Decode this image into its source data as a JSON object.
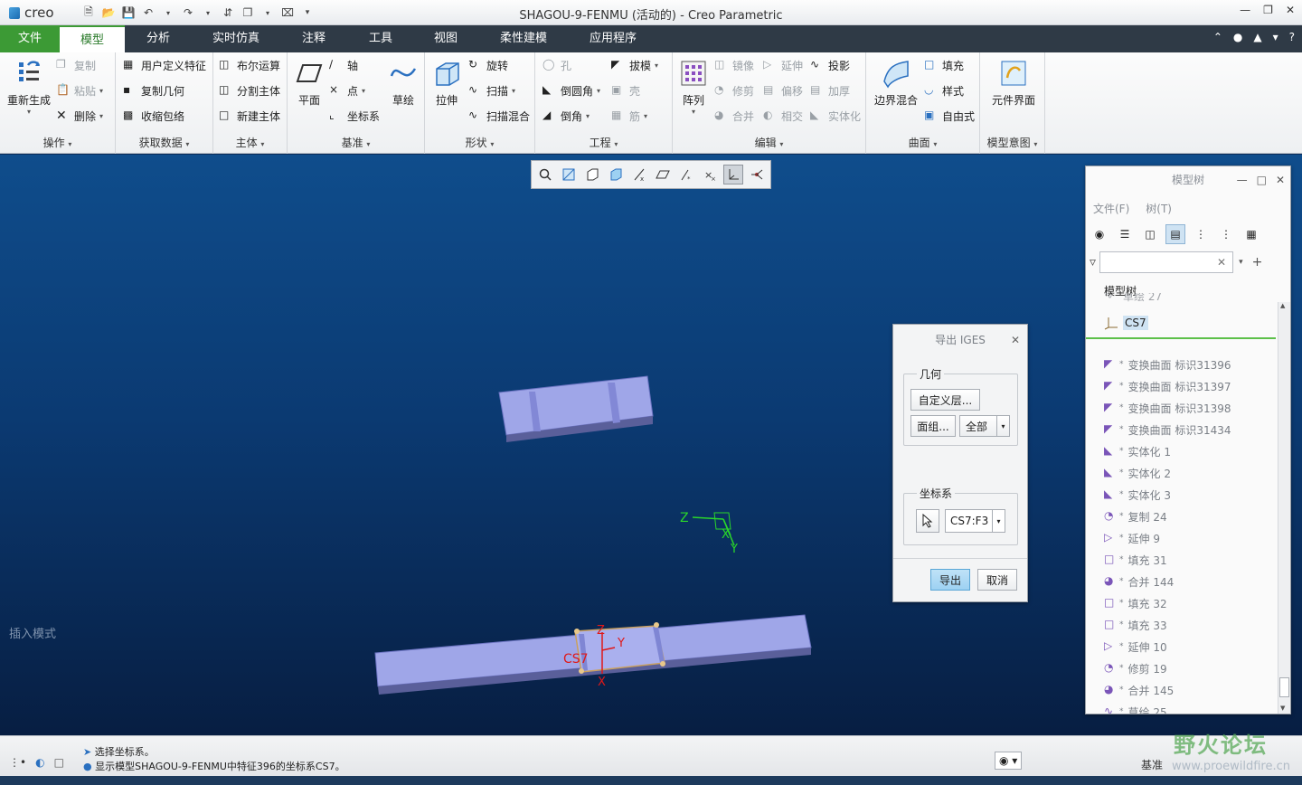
{
  "app": {
    "logo": "creo",
    "title": "SHAGOU-9-FENMU (活动的) - Creo Parametric"
  },
  "tabs": [
    {
      "label": "文件"
    },
    {
      "label": "模型"
    },
    {
      "label": "分析"
    },
    {
      "label": "实时仿真"
    },
    {
      "label": "注释"
    },
    {
      "label": "工具"
    },
    {
      "label": "视图"
    },
    {
      "label": "柔性建模"
    },
    {
      "label": "应用程序"
    }
  ],
  "ribbon": {
    "operations": {
      "label": "操作",
      "regenerate": "重新生成",
      "copy": "复制",
      "paste": "粘贴",
      "delete": "删除"
    },
    "get_data": {
      "label": "获取数据",
      "udf": "用户定义特征",
      "copy_geom": "复制几何",
      "shrinkwrap": "收缩包络"
    },
    "body": {
      "label": "主体",
      "boolean": "布尔运算",
      "split": "分割主体",
      "new_body": "新建主体"
    },
    "datum": {
      "label": "基准",
      "plane": "平面",
      "axis": "轴",
      "point": "点",
      "csys": "坐标系",
      "sketch": "草绘"
    },
    "shapes": {
      "label": "形状",
      "extrude": "拉伸",
      "revolve": "旋转",
      "sweep": "扫描",
      "swept_blend": "扫描混合"
    },
    "engineering": {
      "label": "工程",
      "hole": "孔",
      "round": "倒圆角",
      "chamfer": "倒角",
      "draft": "拔模",
      "shell": "壳",
      "rib": "筋"
    },
    "editing": {
      "label": "编辑",
      "pattern": "阵列",
      "mirror": "镜像",
      "extend": "延伸",
      "project": "投影",
      "trim": "修剪",
      "offset": "偏移",
      "thicken": "加厚",
      "merge": "合并",
      "intersect": "相交",
      "solidify": "实体化"
    },
    "surfaces": {
      "label": "曲面",
      "boundary_blend": "边界混合",
      "fill": "填充",
      "style": "样式",
      "freestyle": "自由式"
    },
    "model_intent": {
      "label": "模型意图",
      "component_interface": "元件界面"
    }
  },
  "viewport": {
    "insert_mode": "插入模式",
    "csys_label_top": [
      "Z",
      "X",
      "Y"
    ],
    "csys_label_part": [
      "CS7",
      "Z",
      "Y",
      "X"
    ]
  },
  "iges_dialog": {
    "title": "导出 IGES",
    "geometry_legend": "几何",
    "custom_layers": "自定义层...",
    "face_group": "面组...",
    "all": "全部",
    "csys_legend": "坐标系",
    "csys_value": "CS7:F3",
    "export": "导出",
    "cancel": "取消"
  },
  "model_tree": {
    "title": "模型树",
    "menu_file": "文件(F)",
    "menu_tree": "树(T)",
    "tree_label": "模型树",
    "partial_row": "草绘 27",
    "selected_row": "CS7",
    "rows": [
      {
        "label": "变换曲面 标识31396",
        "icon": "transform-surface-icon"
      },
      {
        "label": "变换曲面 标识31397",
        "icon": "transform-surface-icon"
      },
      {
        "label": "变换曲面 标识31398",
        "icon": "transform-surface-icon"
      },
      {
        "label": "变换曲面 标识31434",
        "icon": "transform-surface-icon"
      },
      {
        "label": "实体化 1",
        "icon": "solidify-icon"
      },
      {
        "label": "实体化 2",
        "icon": "solidify-icon"
      },
      {
        "label": "实体化 3",
        "icon": "solidify-icon"
      },
      {
        "label": "复制 24",
        "icon": "copy-surface-icon"
      },
      {
        "label": "延伸 9",
        "icon": "extend-icon"
      },
      {
        "label": "填充 31",
        "icon": "fill-icon"
      },
      {
        "label": "合并 144",
        "icon": "merge-icon"
      },
      {
        "label": "填充 32",
        "icon": "fill-icon"
      },
      {
        "label": "填充 33",
        "icon": "fill-icon"
      },
      {
        "label": "延伸 10",
        "icon": "extend-icon"
      },
      {
        "label": "修剪 19",
        "icon": "trim-icon"
      },
      {
        "label": "合并 145",
        "icon": "merge-icon"
      },
      {
        "label": "草绘 25",
        "icon": "sketch-icon"
      }
    ]
  },
  "statusbar": {
    "msg1": "选择坐标系。",
    "msg2": "显示模型SHAGOU-9-FENMU中特征396的坐标系CS7。",
    "jizhun": "基准"
  },
  "watermark": {
    "text": "野火论坛",
    "url": "www.proewildfire.cn"
  }
}
